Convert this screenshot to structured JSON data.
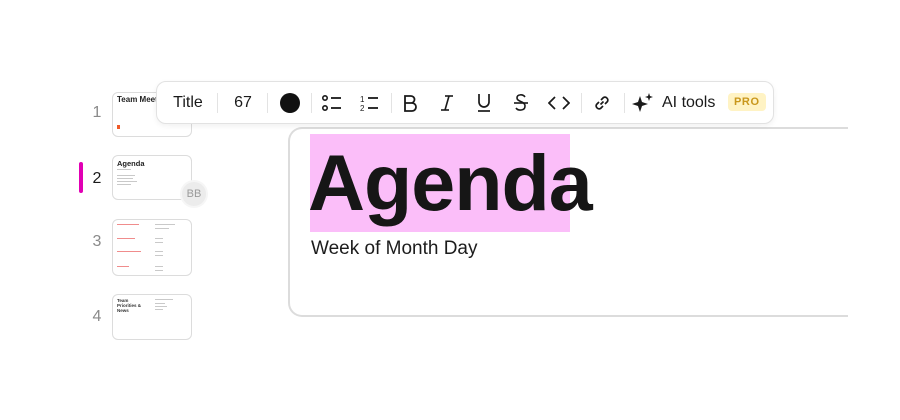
{
  "toolbar": {
    "style_label": "Title",
    "font_size": "67",
    "text_color": "#111111",
    "icons": [
      "bulleted-list-icon",
      "numbered-list-icon",
      "bold-icon",
      "italic-icon",
      "underline-icon",
      "strikethrough-icon",
      "code-icon",
      "link-icon",
      "sparkle-icon"
    ],
    "ai_tools_label": "AI tools",
    "pro_badge": "PRO"
  },
  "slides": [
    {
      "number": "1",
      "thumb_title": "Team Meeting"
    },
    {
      "number": "2",
      "thumb_title": "Agenda",
      "active": true
    },
    {
      "number": "3",
      "thumb_title": ""
    },
    {
      "number": "4",
      "thumb_title": "Team Priorities & News"
    }
  ],
  "collaborator": {
    "initials": "BB"
  },
  "editor": {
    "title": "Agenda",
    "subtitle": "Week of Month Day",
    "highlight_color": "#fbbef9"
  },
  "accent_color": "#e100b4"
}
